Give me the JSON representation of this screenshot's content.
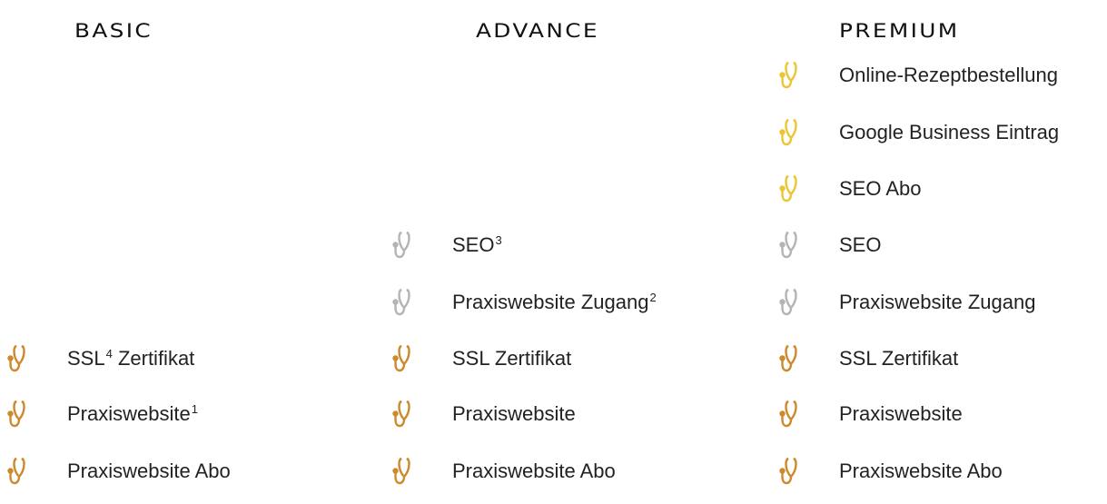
{
  "columns": [
    {
      "heading": "BASIC",
      "features": [
        {
          "text": "SSL",
          "sup": "4",
          "after": " Zertifikat",
          "icon": "stethoscope-icon",
          "tone": "orange"
        },
        {
          "text": "Praxiswebsite",
          "sup": "1",
          "after": "",
          "icon": "stethoscope-icon",
          "tone": "orange"
        },
        {
          "text": "Praxiswebsite Abo",
          "sup": "",
          "after": "",
          "icon": "stethoscope-icon",
          "tone": "orange"
        }
      ]
    },
    {
      "heading": "ADVANCE",
      "features": [
        {
          "text": "SEO",
          "sup": "3",
          "after": "",
          "icon": "stethoscope-icon",
          "tone": "gray"
        },
        {
          "text": "Praxiswebsite Zugang",
          "sup": "2",
          "after": "",
          "icon": "stethoscope-icon",
          "tone": "gray"
        },
        {
          "text": "SSL Zertifikat",
          "sup": "",
          "after": "",
          "icon": "stethoscope-icon",
          "tone": "orange"
        },
        {
          "text": "Praxiswebsite",
          "sup": "",
          "after": "",
          "icon": "stethoscope-icon",
          "tone": "orange"
        },
        {
          "text": "Praxiswebsite Abo",
          "sup": "",
          "after": "",
          "icon": "stethoscope-icon",
          "tone": "orange"
        }
      ]
    },
    {
      "heading": "PREMIUM",
      "features": [
        {
          "text": "Online-Rezeptbestellung",
          "sup": "",
          "after": "",
          "icon": "stethoscope-icon",
          "tone": "gold"
        },
        {
          "text": "Google Business Eintrag",
          "sup": "",
          "after": "",
          "icon": "stethoscope-icon",
          "tone": "gold"
        },
        {
          "text": "SEO Abo",
          "sup": "",
          "after": "",
          "icon": "stethoscope-icon",
          "tone": "gold"
        },
        {
          "text": "SEO",
          "sup": "",
          "after": "",
          "icon": "stethoscope-icon",
          "tone": "gray"
        },
        {
          "text": "Praxiswebsite Zugang",
          "sup": "",
          "after": "",
          "icon": "stethoscope-icon",
          "tone": "gray"
        },
        {
          "text": "SSL Zertifikat",
          "sup": "",
          "after": "",
          "icon": "stethoscope-icon",
          "tone": "orange"
        },
        {
          "text": "Praxiswebsite",
          "sup": "",
          "after": "",
          "icon": "stethoscope-icon",
          "tone": "orange"
        },
        {
          "text": "Praxiswebsite Abo",
          "sup": "",
          "after": "",
          "icon": "stethoscope-icon",
          "tone": "orange"
        }
      ]
    }
  ],
  "colors": {
    "orange": "#cd8a2c",
    "gray": "#b4b4b4",
    "gold": "#ecc534",
    "text": "#222222",
    "heading": "#111111"
  }
}
